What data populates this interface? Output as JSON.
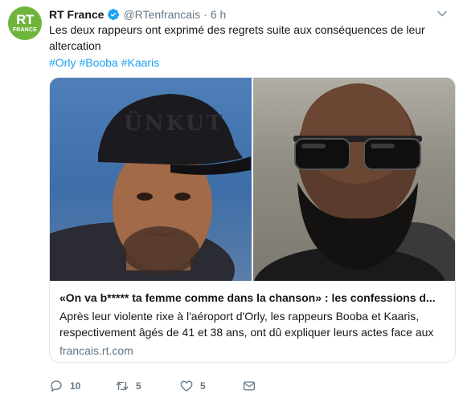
{
  "tweet": {
    "author_name": "RT France",
    "handle": "@RTenfrancais",
    "separator": "·",
    "time": "6 h",
    "avatar_line1": "RT",
    "avatar_line2": "FRANCE",
    "text": "Les deux rappeurs ont exprimé des regrets suite aux conséquences de leur altercation",
    "hashtags": [
      "#Orly",
      "#Booba",
      "#Kaaris"
    ]
  },
  "card": {
    "title": "«On va b***** ta femme comme dans la chanson» : les confessions d...",
    "description": "Après leur violente rixe à l'aéroport d'Orly, les rappeurs Booba et Kaaris, respectivement âgés de 41 et 38 ans, ont dû expliquer leurs actes face aux",
    "domain": "francais.rt.com",
    "cap_text": "ÜNKUT"
  },
  "actions": {
    "reply_count": "10",
    "retweet_count": "5",
    "like_count": "5"
  },
  "colors": {
    "brand_green": "#6fb53d",
    "link_blue": "#1da1f2",
    "muted": "#657786"
  }
}
